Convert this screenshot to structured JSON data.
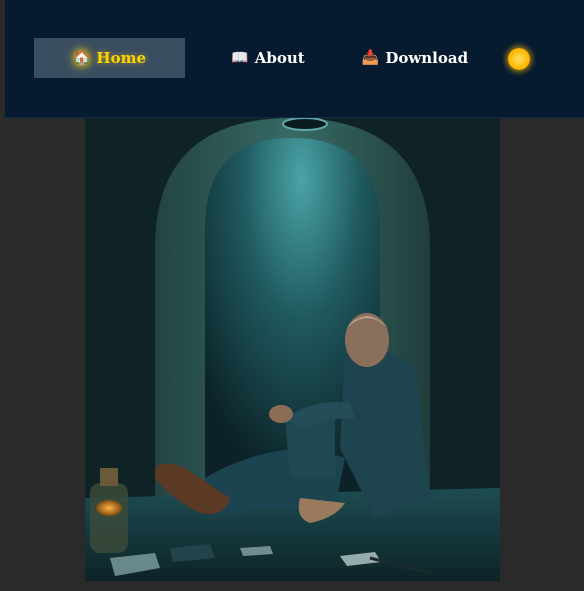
{
  "nav": {
    "items": [
      {
        "label": "Home",
        "icon": "🏠",
        "icon_name": "home-icon",
        "active": true
      },
      {
        "label": "About",
        "icon": "📖",
        "icon_name": "book-icon",
        "active": false
      },
      {
        "label": "Download",
        "icon": "📥",
        "icon_name": "inbox-tray-icon",
        "active": false
      }
    ],
    "theme_toggle_icon": "sun-icon"
  },
  "colors": {
    "navbar_bg": "#061a30",
    "page_bg": "#2a2a2a",
    "active_item_bg": "#3a4d61",
    "active_text": "#ffd400",
    "nav_text": "#ffffff"
  },
  "hero": {
    "subject": "painting of a man sitting in an arched teal-lit stone cell"
  }
}
